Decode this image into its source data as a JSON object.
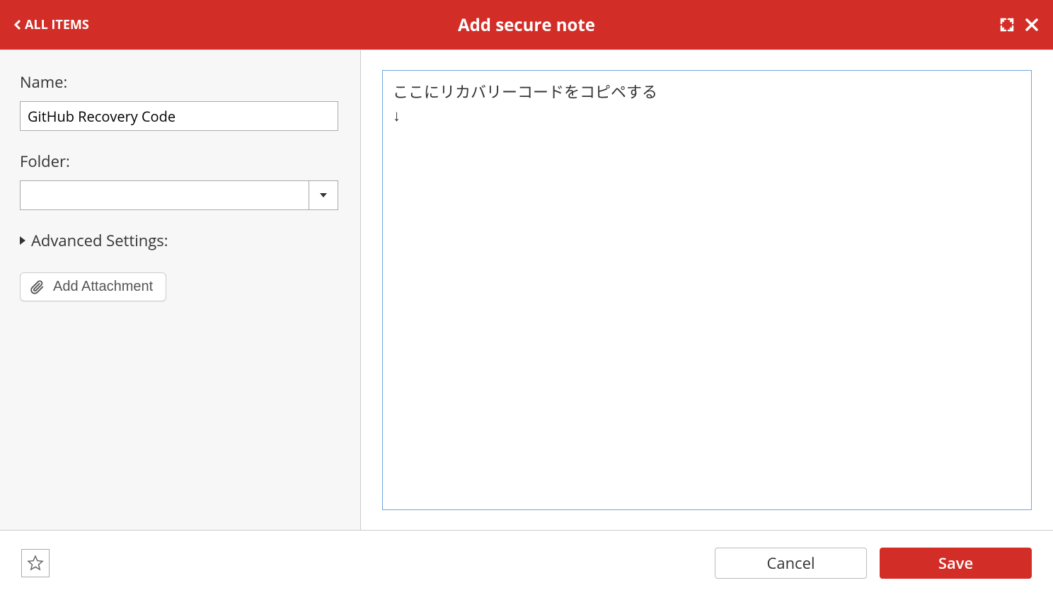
{
  "header": {
    "back_label": "ALL ITEMS",
    "title": "Add secure note"
  },
  "form": {
    "name_label": "Name:",
    "name_value": "GitHub Recovery Code",
    "folder_label": "Folder:",
    "folder_value": "",
    "advanced_label": "Advanced Settings:",
    "attachment_label": "Add Attachment"
  },
  "note": {
    "content": "ここにリカバリーコードをコピペする\n↓"
  },
  "footer": {
    "cancel_label": "Cancel",
    "save_label": "Save"
  }
}
